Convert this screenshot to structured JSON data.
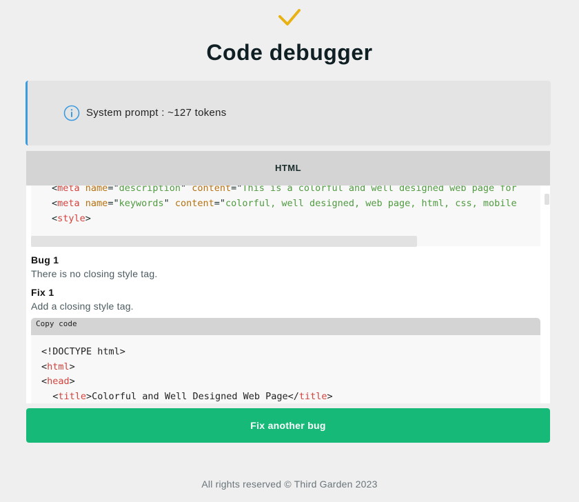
{
  "page": {
    "title": "Code debugger",
    "accent_color": "#e8b214",
    "button_color": "#17b978",
    "info_border_color": "#3b9be0"
  },
  "info": {
    "icon": "info-icon",
    "text": "System prompt : ~127 tokens"
  },
  "panel": {
    "header": "HTML",
    "original_code": [
      [
        {
          "t": "<",
          "c": "p"
        },
        {
          "t": "meta",
          "c": "tag"
        },
        {
          "t": " ",
          "c": "p"
        },
        {
          "t": "name",
          "c": "attr"
        },
        {
          "t": "=\"",
          "c": "p"
        },
        {
          "t": "description",
          "c": "str"
        },
        {
          "t": "\" ",
          "c": "p"
        },
        {
          "t": "content",
          "c": "attr"
        },
        {
          "t": "=\"",
          "c": "p"
        },
        {
          "t": "This is a colorful and well designed web page for",
          "c": "str"
        }
      ],
      [
        {
          "t": "<",
          "c": "p"
        },
        {
          "t": "meta",
          "c": "tag"
        },
        {
          "t": " ",
          "c": "p"
        },
        {
          "t": "name",
          "c": "attr"
        },
        {
          "t": "=\"",
          "c": "p"
        },
        {
          "t": "keywords",
          "c": "str"
        },
        {
          "t": "\" ",
          "c": "p"
        },
        {
          "t": "content",
          "c": "attr"
        },
        {
          "t": "=\"",
          "c": "p"
        },
        {
          "t": "colorful, well designed, web page, html, css, mobile",
          "c": "str"
        }
      ],
      [
        {
          "t": "<",
          "c": "p"
        },
        {
          "t": "style",
          "c": "tag"
        },
        {
          "t": ">",
          "c": "p"
        }
      ]
    ],
    "bug_title": "Bug 1",
    "bug_text": "There is no closing style tag.",
    "fix_title": "Fix 1",
    "fix_text": "Add a closing style tag.",
    "copy_label": "Copy code",
    "fixed_code": [
      [
        {
          "t": "<!DOCTYPE html>",
          "c": "p"
        }
      ],
      [
        {
          "t": "<",
          "c": "p"
        },
        {
          "t": "html",
          "c": "tag"
        },
        {
          "t": ">",
          "c": "p"
        }
      ],
      [
        {
          "t": "<",
          "c": "p"
        },
        {
          "t": "head",
          "c": "tag"
        },
        {
          "t": ">",
          "c": "p"
        }
      ],
      [
        {
          "t": "  <",
          "c": "p"
        },
        {
          "t": "title",
          "c": "tag"
        },
        {
          "t": ">Colorful and Well Designed Web Page</",
          "c": "p"
        },
        {
          "t": "title",
          "c": "tag"
        },
        {
          "t": ">",
          "c": "p"
        }
      ]
    ]
  },
  "actions": {
    "fix_another_label": "Fix another bug"
  },
  "footer": {
    "text": "All rights reserved © Third Garden 2023"
  }
}
